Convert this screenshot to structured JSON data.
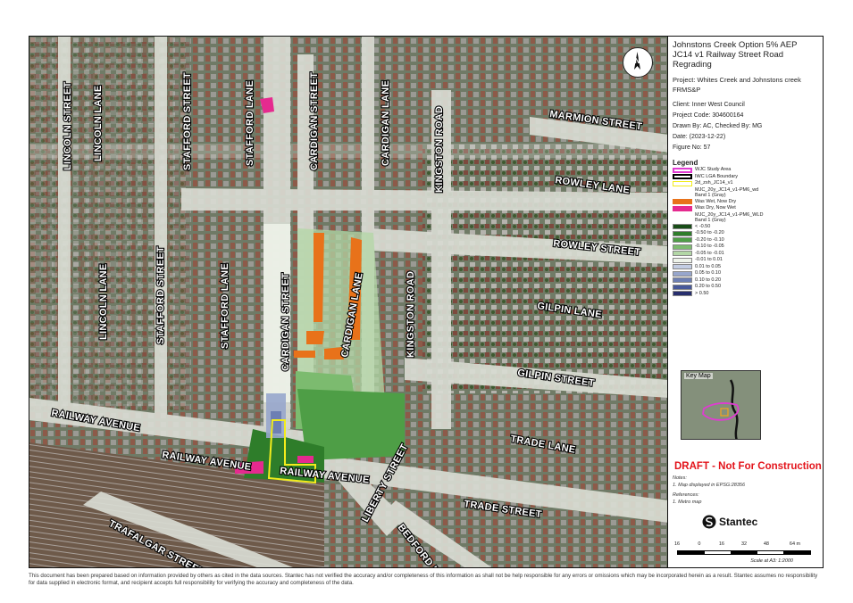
{
  "map": {
    "streets": [
      {
        "id": "lincoln-street",
        "name": "LINCOLN STREET"
      },
      {
        "id": "lincoln-lane-top",
        "name": "LINCOLN LANE"
      },
      {
        "id": "stafford-street-top",
        "name": "STAFFORD STREET"
      },
      {
        "id": "stafford-lane-top",
        "name": "STAFFORD LANE"
      },
      {
        "id": "cardigan-street-top",
        "name": "CARDIGAN STREET"
      },
      {
        "id": "cardigan-lane-top",
        "name": "CARDIGAN LANE"
      },
      {
        "id": "kingston-road-top",
        "name": "KINGSTON ROAD"
      },
      {
        "id": "marmion-street",
        "name": "MARMION STREET"
      },
      {
        "id": "rowley-lane",
        "name": "ROWLEY LANE"
      },
      {
        "id": "rowley-street",
        "name": "ROWLEY STREET"
      },
      {
        "id": "lincoln-lane-bottom",
        "name": "LINCOLN LANE"
      },
      {
        "id": "stafford-street-bottom",
        "name": "STAFFORD STREET"
      },
      {
        "id": "stafford-lane-bottom",
        "name": "STAFFORD LANE"
      },
      {
        "id": "cardigan-street-bottom",
        "name": "CARDIGAN STREET"
      },
      {
        "id": "cardigan-lane-bottom",
        "name": "CARDIGAN LANE"
      },
      {
        "id": "kingston-road-bottom",
        "name": "KINGSTON ROAD"
      },
      {
        "id": "gilpin-lane",
        "name": "GILPIN LANE"
      },
      {
        "id": "gilpin-street",
        "name": "GILPIN STREET"
      },
      {
        "id": "railway-avenue-left",
        "name": "RAILWAY AVENUE"
      },
      {
        "id": "railway-avenue-mid",
        "name": "RAILWAY AVENUE"
      },
      {
        "id": "railway-avenue-right",
        "name": "RAILWAY AVENUE"
      },
      {
        "id": "trade-lane",
        "name": "TRADE LANE"
      },
      {
        "id": "liberty-street",
        "name": "LIBERTY STREET"
      },
      {
        "id": "trade-street",
        "name": "TRADE STREET"
      },
      {
        "id": "trafalgar-street",
        "name": "TRAFALGAR STREET"
      },
      {
        "id": "bedford-lane",
        "name": "BEDFORD LANE"
      }
    ],
    "north_label": "N"
  },
  "panel": {
    "title_lines": [
      "Johnstons Creek Option 5% AEP",
      "JC14 v1 Railway Street Road",
      "Regrading"
    ],
    "project_label": "Project:",
    "project_value": "Whites Creek and Johnstons creek FRMS&P",
    "client": "Client:  Inner West Council",
    "project_code": "Project Code:  304600164",
    "drawn_by": "Drawn By:  AC, Checked By: MG",
    "date": "Date:  (2023-12-22)",
    "figure_no": "Figure No:  57",
    "legend_title": "Legend",
    "legend_items": [
      {
        "label": "WJC Study Area",
        "color": "#e03bd2",
        "style": "outline"
      },
      {
        "label": "IWC LGA Boundary",
        "color": "#000000",
        "style": "outline"
      },
      {
        "label": "2d_zsh_JC14_v1",
        "color": "#f2ec1c",
        "style": "outline"
      }
    ],
    "wd_layer": "MJC_20y_JC14_v1-PM6_wd",
    "wd_band": "Band 1 (Gray)",
    "wd_items": [
      {
        "label": "Was Wet, Now Dry",
        "color": "#e8721a"
      },
      {
        "label": "Was Dry, Now Wet",
        "color": "#e52a8f"
      }
    ],
    "wld_layer": "MJC_20y_JC14_v1-PM6_WLD",
    "wld_band": "Band 1 (Gray)",
    "wld_items": [
      {
        "label": "< -0.50",
        "color": "#184d17"
      },
      {
        "label": "-0.50 to -0.20",
        "color": "#2e7d2a"
      },
      {
        "label": "-0.20 to -0.10",
        "color": "#4e9e46"
      },
      {
        "label": "-0.10 to -0.05",
        "color": "#7cbb6f"
      },
      {
        "label": "-0.05 to -0.01",
        "color": "#b3d7a6"
      },
      {
        "label": "-0.01 to 0.01",
        "color": "#eef3ea"
      },
      {
        "label": "0.01 to 0.05",
        "color": "#c3cde3"
      },
      {
        "label": "0.05 to 0.10",
        "color": "#97a6cc"
      },
      {
        "label": "0.10 to 0.20",
        "color": "#6d7fb4"
      },
      {
        "label": "0.20 to 0.50",
        "color": "#47589a"
      },
      {
        "label": "> 0.50",
        "color": "#272e6d"
      }
    ],
    "key_map_label": "Key Map",
    "draft": "DRAFT - Not For Construction",
    "notes_title": "Notes:",
    "notes_1": "1. Map displayed in EPSG:28356",
    "references_title": "References:",
    "references_1": "1. Metro map",
    "brand": "Stantec",
    "scale_ticks": [
      "16",
      "0",
      "16",
      "32",
      "48",
      "64 m"
    ],
    "scale_note": "Scale at A3: 1:2000"
  },
  "disclaimer": "This document has been prepared based on information provided by others as cited in the data sources. Stantec has not verified the accuracy and/or completeness of this information as shall not be help responsible for any errors or omissions which may be incorporated herein as a result. Stantec assumes no responsibility for data supplied in electronic format, and recipient accepts full responsibility for verifying the accuracy and completeness of the data."
}
